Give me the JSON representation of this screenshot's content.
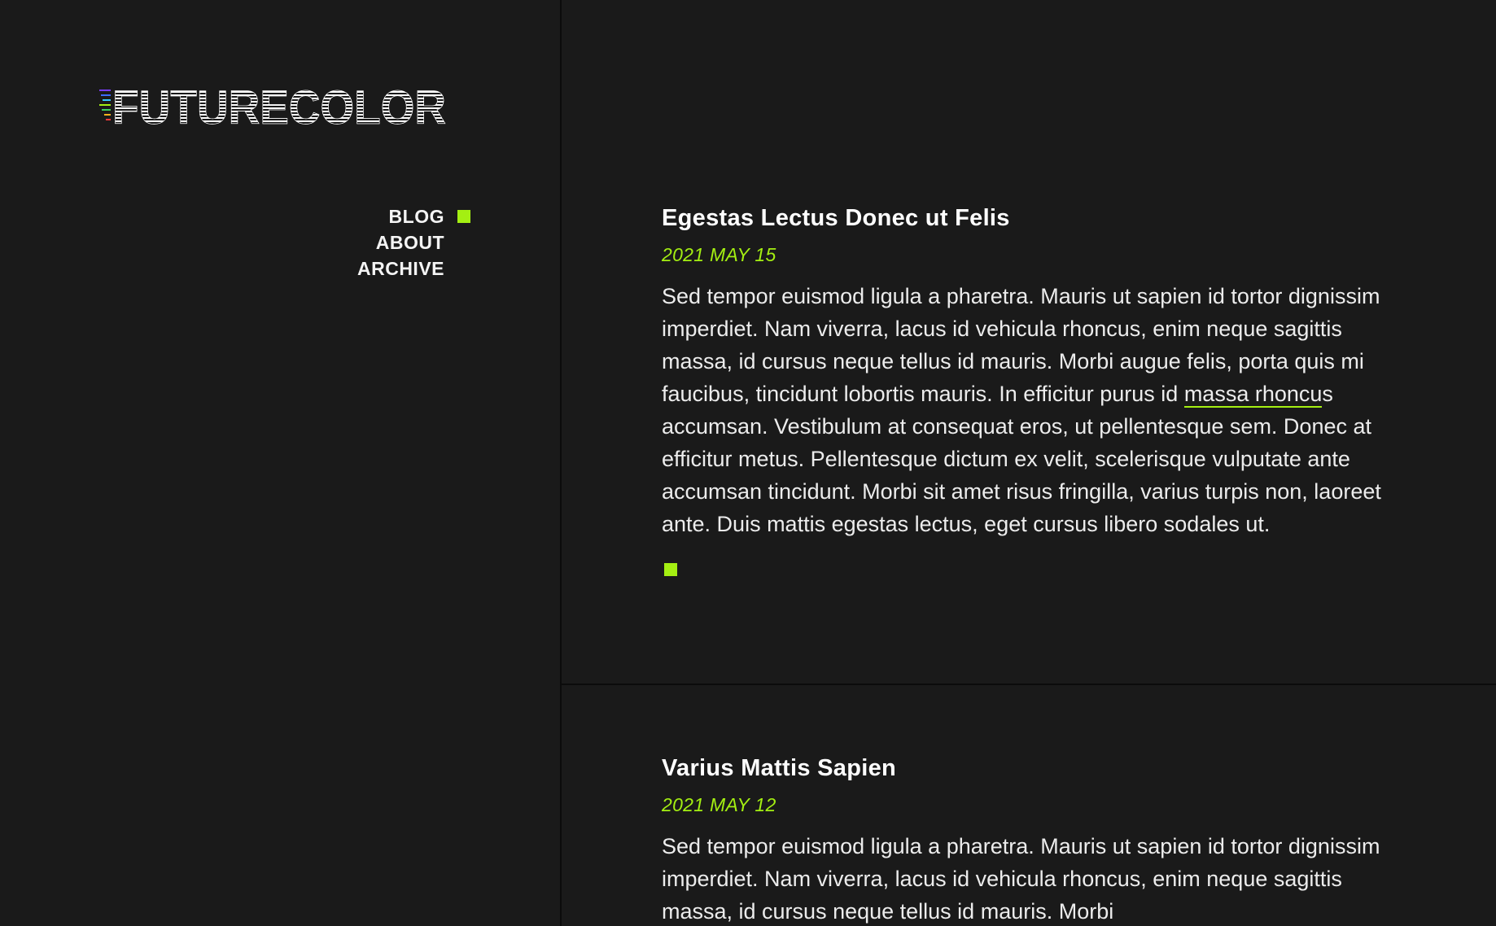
{
  "brand": {
    "logo_text": "FUTURECOLOR",
    "accent_color": "#a4ef12",
    "background_color": "#1a1a1a"
  },
  "nav": {
    "items": [
      {
        "label": "BLOG",
        "active": true
      },
      {
        "label": "ABOUT",
        "active": false
      },
      {
        "label": "ARCHIVE",
        "active": false
      }
    ]
  },
  "posts": [
    {
      "title": "Egestas Lectus Donec ut Felis",
      "date": "2021 MAY 15",
      "body_before_link": "Sed tempor euismod ligula a pharetra. Mauris ut sapien id tortor dignissim imperdiet. Nam viverra, lacus id vehicula rhoncus, enim neque sagittis massa, id cursus neque tellus id mauris. Morbi augue felis, porta quis mi faucibus, tincidunt lobortis mauris. In efficitur purus id ",
      "link_text": "massa rhoncu",
      "body_after_link": "s accumsan. Vestibulum at consequat eros, ut pellentesque sem. Donec at efficitur metus. Pellentesque dictum ex velit, scelerisque vulputate ante accumsan tincidunt. Morbi sit amet risus fringilla, varius turpis non, laoreet ante. Duis mattis egestas lectus, eget cursus libero sodales ut."
    },
    {
      "title": "Varius Mattis Sapien",
      "date": "2021 MAY 12",
      "body": "Sed tempor euismod ligula a pharetra. Mauris ut sapien id tortor dignissim imperdiet. Nam viverra, lacus id vehicula rhoncus, enim neque sagittis massa, id cursus neque tellus id mauris. Morbi"
    }
  ]
}
